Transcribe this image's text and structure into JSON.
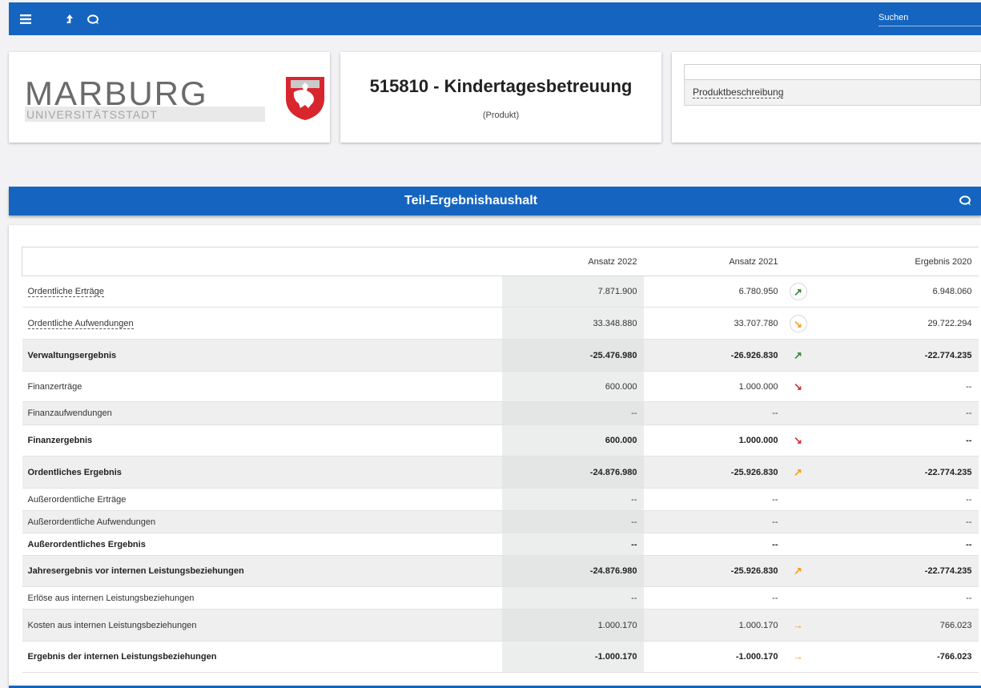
{
  "topbar": {
    "search_placeholder": "Suchen",
    "icons": [
      "menu-icon",
      "upload-icon",
      "chat-icon"
    ]
  },
  "logo": {
    "main_text": "MARBURG",
    "sub_text": "UNIVERSITÄTSSTADT"
  },
  "product": {
    "title": "515810 - Kindertagesbetreuung",
    "subtitle": "(Produkt)"
  },
  "description": {
    "link_label": "Produktbeschreibung"
  },
  "section": {
    "title": "Teil-Ergebnishaushalt"
  },
  "colors": {
    "brand_blue": "#1565c0",
    "trend_up_green": "#2e8b3a",
    "trend_down_red": "#d32f2f",
    "trend_orange": "#f0a020"
  },
  "table": {
    "headers": [
      "",
      "Ansatz 2022",
      "Ansatz 2021",
      "",
      "Ergebnis 2020"
    ],
    "rows": [
      {
        "label": "Ordentliche Erträge",
        "a2022": "7.871.900",
        "a2021": "6.780.950",
        "trend": "up",
        "trend_color": "#2e8b3a",
        "circle": true,
        "e2020": "6.948.060",
        "bold": false,
        "grey": false,
        "link": true
      },
      {
        "label": "Ordentliche Aufwendungen",
        "a2022": "33.348.880",
        "a2021": "33.707.780",
        "trend": "down",
        "trend_color": "#f0a020",
        "circle": true,
        "e2020": "29.722.294",
        "bold": false,
        "grey": false,
        "link": true
      },
      {
        "label": "Verwaltungsergebnis",
        "a2022": "-25.476.980",
        "a2021": "-26.926.830",
        "trend": "up",
        "trend_color": "#2e8b3a",
        "circle": false,
        "e2020": "-22.774.235",
        "bold": true,
        "grey": true,
        "link": false
      },
      {
        "label": "Finanzerträge",
        "a2022": "600.000",
        "a2021": "1.000.000",
        "trend": "down",
        "trend_color": "#d32f2f",
        "circle": false,
        "e2020": "--",
        "bold": false,
        "grey": false,
        "link": false
      },
      {
        "label": "Finanzaufwendungen",
        "a2022": "--",
        "a2021": "--",
        "trend": "",
        "trend_color": "",
        "circle": false,
        "e2020": "--",
        "bold": false,
        "grey": true,
        "link": false
      },
      {
        "label": "Finanzergebnis",
        "a2022": "600.000",
        "a2021": "1.000.000",
        "trend": "down",
        "trend_color": "#d32f2f",
        "circle": false,
        "e2020": "--",
        "bold": true,
        "grey": false,
        "link": false
      },
      {
        "label": "Ordentliches Ergebnis",
        "a2022": "-24.876.980",
        "a2021": "-25.926.830",
        "trend": "up",
        "trend_color": "#f0a020",
        "circle": false,
        "e2020": "-22.774.235",
        "bold": true,
        "grey": true,
        "link": false
      },
      {
        "label": "Außerordentliche Erträge",
        "a2022": "--",
        "a2021": "--",
        "trend": "",
        "trend_color": "",
        "circle": false,
        "e2020": "--",
        "bold": false,
        "grey": false,
        "link": false
      },
      {
        "label": "Außerordentliche Aufwendungen",
        "a2022": "--",
        "a2021": "--",
        "trend": "",
        "trend_color": "",
        "circle": false,
        "e2020": "--",
        "bold": false,
        "grey": true,
        "link": false
      },
      {
        "label": "Außerordentliches Ergebnis",
        "a2022": "--",
        "a2021": "--",
        "trend": "",
        "trend_color": "",
        "circle": false,
        "e2020": "--",
        "bold": true,
        "grey": false,
        "link": false
      },
      {
        "label": "Jahresergebnis vor internen Leistungsbeziehungen",
        "a2022": "-24.876.980",
        "a2021": "-25.926.830",
        "trend": "up",
        "trend_color": "#f0a020",
        "circle": false,
        "e2020": "-22.774.235",
        "bold": true,
        "grey": true,
        "link": false
      },
      {
        "label": "Erlöse aus internen Leistungsbeziehungen",
        "a2022": "--",
        "a2021": "--",
        "trend": "",
        "trend_color": "",
        "circle": false,
        "e2020": "--",
        "bold": false,
        "grey": false,
        "link": false
      },
      {
        "label": "Kosten aus internen Leistungsbeziehungen",
        "a2022": "1.000.170",
        "a2021": "1.000.170",
        "trend": "right",
        "trend_color": "#f0a020",
        "circle": false,
        "e2020": "766.023",
        "bold": false,
        "grey": true,
        "link": false
      },
      {
        "label": "Ergebnis der internen Leistungsbeziehungen",
        "a2022": "-1.000.170",
        "a2021": "-1.000.170",
        "trend": "right",
        "trend_color": "#f0a020",
        "circle": false,
        "e2020": "-766.023",
        "bold": true,
        "grey": false,
        "link": false
      }
    ]
  }
}
